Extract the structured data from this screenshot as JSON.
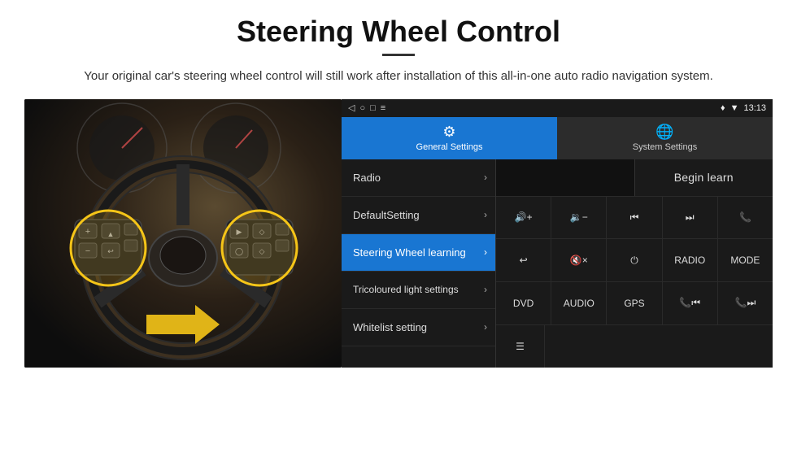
{
  "header": {
    "title": "Steering Wheel Control",
    "subtitle": "Your original car's steering wheel control will still work after installation of this all-in-one auto radio navigation system."
  },
  "status_bar": {
    "time": "13:13",
    "icons": [
      "◁",
      "○",
      "□",
      "≡"
    ]
  },
  "tabs": [
    {
      "id": "general",
      "label": "General Settings",
      "icon": "⚙",
      "active": true
    },
    {
      "id": "system",
      "label": "System Settings",
      "icon": "🌐",
      "active": false
    }
  ],
  "nav_items": [
    {
      "id": "radio",
      "label": "Radio",
      "active": false
    },
    {
      "id": "default",
      "label": "DefaultSetting",
      "active": false
    },
    {
      "id": "steering",
      "label": "Steering Wheel learning",
      "active": true
    },
    {
      "id": "tricoloured",
      "label": "Tricoloured light settings",
      "active": false
    },
    {
      "id": "whitelist",
      "label": "Whitelist setting",
      "active": false
    }
  ],
  "right_panel": {
    "begin_learn_label": "Begin learn",
    "button_rows": [
      [
        {
          "id": "vol-up",
          "label": "🔊+",
          "type": "icon"
        },
        {
          "id": "vol-down",
          "label": "🔉−",
          "type": "icon"
        },
        {
          "id": "prev-track",
          "label": "⏮",
          "type": "icon"
        },
        {
          "id": "next-track",
          "label": "⏭",
          "type": "icon"
        },
        {
          "id": "phone",
          "label": "📞",
          "type": "icon"
        }
      ],
      [
        {
          "id": "hang-up",
          "label": "↩",
          "type": "icon"
        },
        {
          "id": "mute",
          "label": "🔇×",
          "type": "icon"
        },
        {
          "id": "power",
          "label": "⏻",
          "type": "icon"
        },
        {
          "id": "radio-btn",
          "label": "RADIO",
          "type": "text"
        },
        {
          "id": "mode-btn",
          "label": "MODE",
          "type": "text"
        }
      ],
      [
        {
          "id": "dvd-btn",
          "label": "DVD",
          "type": "text"
        },
        {
          "id": "audio-btn",
          "label": "AUDIO",
          "type": "text"
        },
        {
          "id": "gps-btn",
          "label": "GPS",
          "type": "text"
        },
        {
          "id": "tel-prev",
          "label": "📞⏮",
          "type": "icon"
        },
        {
          "id": "tel-next",
          "label": "📞⏭",
          "type": "icon"
        }
      ]
    ],
    "whitelist_icon": "≡"
  }
}
